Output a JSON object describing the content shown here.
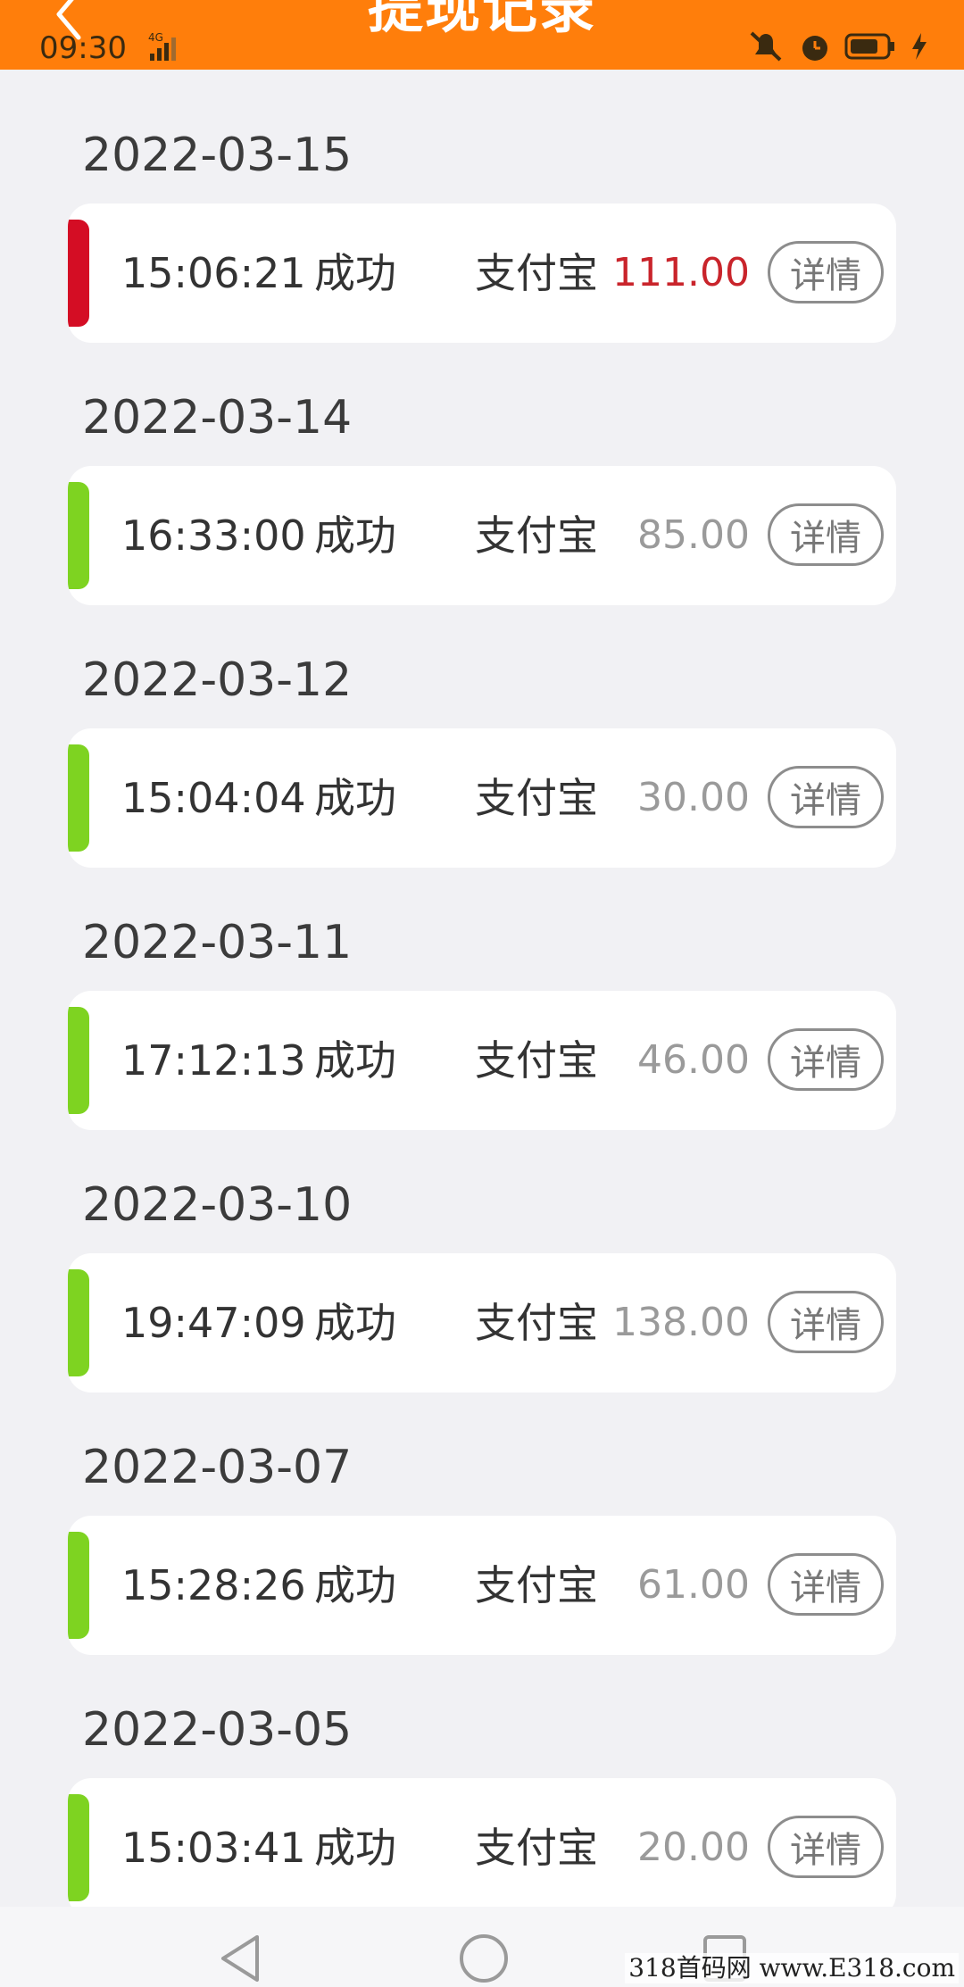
{
  "header": {
    "title": "提现记录",
    "status_time": "09:30",
    "network": "4G",
    "bg_color": "#ff7e0b"
  },
  "colors": {
    "highlight_bar": "#d40d24",
    "normal_bar": "#7ed321",
    "highlight_amount": "#c9242b",
    "normal_amount": "#9a9a9a"
  },
  "records": [
    {
      "date": "2022-03-15",
      "time": "15:06:21",
      "status": "成功",
      "method": "支付宝",
      "amount": "111.00",
      "highlight": true,
      "detail_label": "详情"
    },
    {
      "date": "2022-03-14",
      "time": "16:33:00",
      "status": "成功",
      "method": "支付宝",
      "amount": "85.00",
      "highlight": false,
      "detail_label": "详情"
    },
    {
      "date": "2022-03-12",
      "time": "15:04:04",
      "status": "成功",
      "method": "支付宝",
      "amount": "30.00",
      "highlight": false,
      "detail_label": "详情"
    },
    {
      "date": "2022-03-11",
      "time": "17:12:13",
      "status": "成功",
      "method": "支付宝",
      "amount": "46.00",
      "highlight": false,
      "detail_label": "详情"
    },
    {
      "date": "2022-03-10",
      "time": "19:47:09",
      "status": "成功",
      "method": "支付宝",
      "amount": "138.00",
      "highlight": false,
      "detail_label": "详情"
    },
    {
      "date": "2022-03-07",
      "time": "15:28:26",
      "status": "成功",
      "method": "支付宝",
      "amount": "61.00",
      "highlight": false,
      "detail_label": "详情"
    },
    {
      "date": "2022-03-05",
      "time": "15:03:41",
      "status": "成功",
      "method": "支付宝",
      "amount": "20.00",
      "highlight": false,
      "detail_label": "详情"
    }
  ],
  "watermark": "318首码网 www.E318.com"
}
